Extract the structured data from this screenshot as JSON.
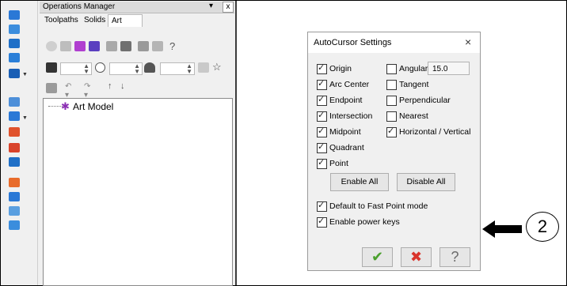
{
  "operations_manager": {
    "title": "Operations Manager",
    "tabs": [
      "Toolpaths",
      "Solids",
      "Art"
    ],
    "tree_root": "Art Model"
  },
  "dialog": {
    "title": "AutoCursor Settings",
    "close": "×",
    "options_left": [
      {
        "label": "Origin",
        "checked": true
      },
      {
        "label": "Arc Center",
        "checked": true
      },
      {
        "label": "Endpoint",
        "checked": true
      },
      {
        "label": "Intersection",
        "checked": true
      },
      {
        "label": "Midpoint",
        "checked": true
      },
      {
        "label": "Quadrant",
        "checked": true
      },
      {
        "label": "Point",
        "checked": true
      }
    ],
    "options_right": [
      {
        "label": "Angular",
        "checked": false
      },
      {
        "label": "Tangent",
        "checked": false
      },
      {
        "label": "Perpendicular",
        "checked": false
      },
      {
        "label": "Nearest",
        "checked": false
      },
      {
        "label": "Horizontal / Vertical",
        "checked": true
      }
    ],
    "angle_value": "15.0",
    "enable_all": "Enable All",
    "disable_all": "Disable All",
    "default_fast_point": {
      "label": "Default to Fast Point mode",
      "checked": true
    },
    "enable_power_keys": {
      "label": "Enable power keys",
      "checked": true
    },
    "ok_glyph": "✔",
    "cancel_glyph": "✖",
    "help_glyph": "?",
    "colors": {
      "ok": "#4aa02c",
      "cancel": "#d9342b",
      "help": "#6a6a6a"
    }
  },
  "callout": {
    "number": "2"
  },
  "icons": [
    "pin-icon",
    "close-icon",
    "gear-icon",
    "check-icon",
    "x-icon",
    "help-icon",
    "arrow-left-icon"
  ]
}
